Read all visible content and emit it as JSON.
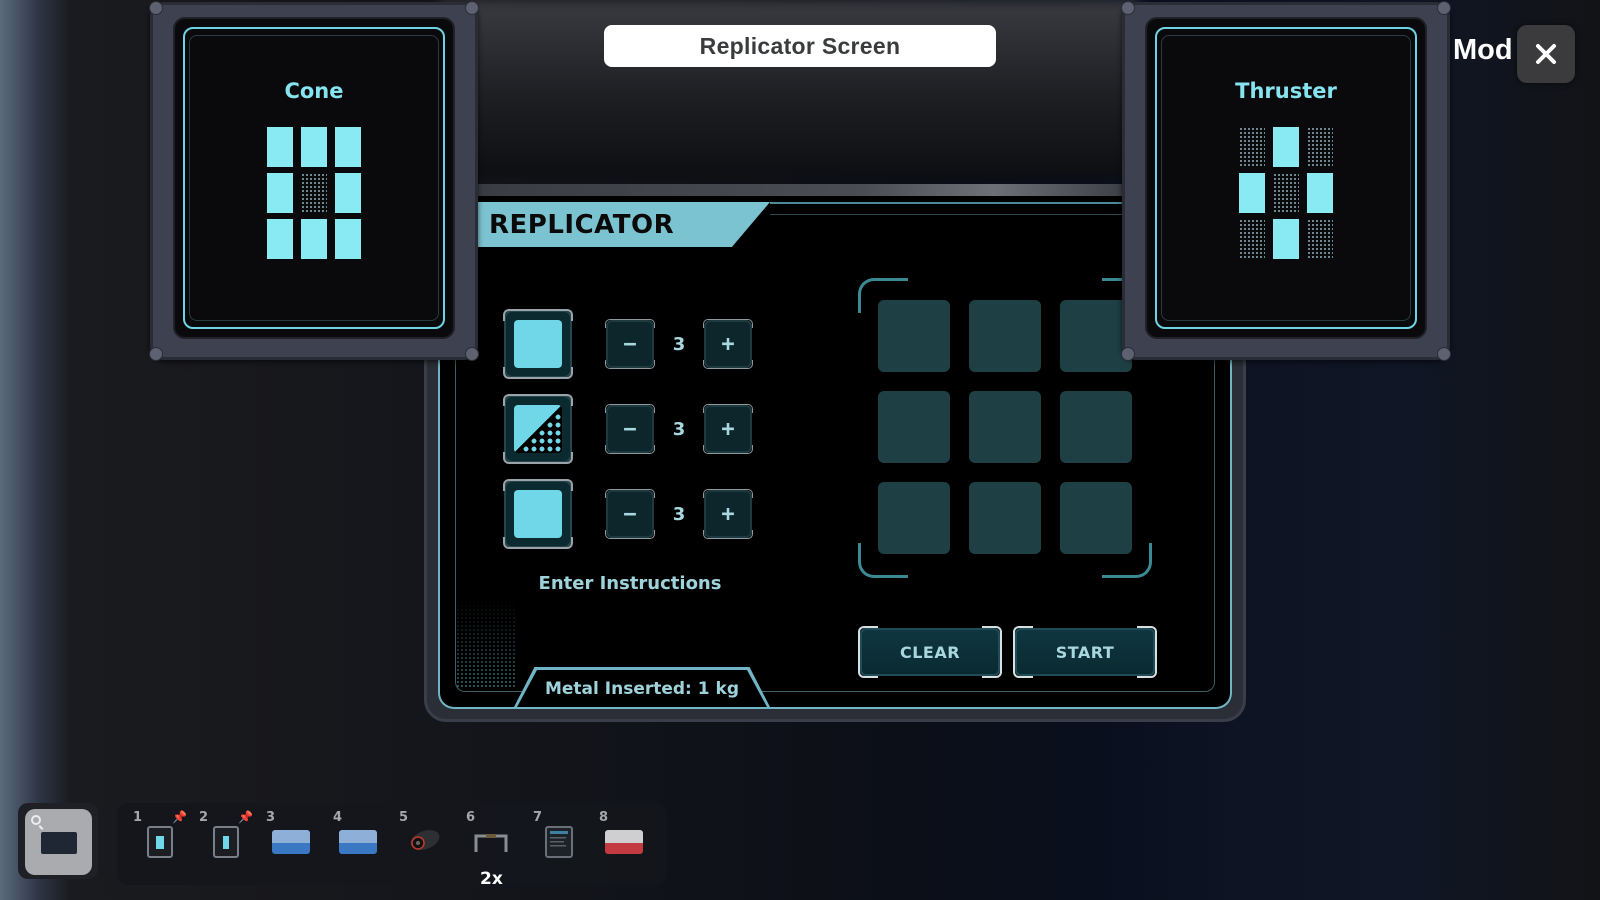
{
  "window": {
    "title": "Replicator Screen",
    "mod_label": "Mod",
    "close_icon": "close-icon"
  },
  "recipes": [
    {
      "title": "Cone",
      "pattern": [
        1,
        1,
        1,
        1,
        0,
        1,
        1,
        1,
        1
      ]
    },
    {
      "title": "Thruster",
      "pattern": [
        0,
        1,
        0,
        1,
        0,
        1,
        0,
        1,
        0
      ]
    }
  ],
  "replicator": {
    "title": "REPLICATOR",
    "ingredients": [
      {
        "shape": "square",
        "icon": "full-block-icon",
        "count": "3",
        "minus": "−",
        "plus": "+"
      },
      {
        "shape": "diagonal",
        "icon": "slope-block-icon",
        "count": "3",
        "minus": "−",
        "plus": "+"
      },
      {
        "shape": "square",
        "icon": "full-block-icon",
        "count": "3",
        "minus": "−",
        "plus": "+"
      }
    ],
    "instructions_label": "Enter Instructions",
    "output_grid": [
      0,
      0,
      0,
      0,
      0,
      0,
      0,
      0,
      0
    ],
    "clear_label": "CLEAR",
    "start_label": "START",
    "metal_inserted": "Metal Inserted: 1 kg"
  },
  "colors": {
    "accent": "#7cc3d1",
    "active_cell": "#8aeaf4",
    "empty_cell": "#1e3f44"
  },
  "hotbar": {
    "slots": [
      {
        "number": "1",
        "item": "cone-recipe-card-icon",
        "pinned": true
      },
      {
        "number": "2",
        "item": "thruster-recipe-card-icon",
        "pinned": true
      },
      {
        "number": "3",
        "item": "blue-keycard-icon",
        "pinned": false
      },
      {
        "number": "4",
        "item": "blue-keycard-icon",
        "pinned": false
      },
      {
        "number": "5",
        "item": "thruster-part-icon",
        "pinned": false
      },
      {
        "number": "6",
        "item": "handle-bar-icon",
        "pinned": false
      },
      {
        "number": "7",
        "item": "datapad-icon",
        "pinned": false
      },
      {
        "number": "8",
        "item": "red-keycard-icon",
        "pinned": false
      }
    ],
    "pin_glyph": "📌",
    "stack_count": "2x"
  }
}
